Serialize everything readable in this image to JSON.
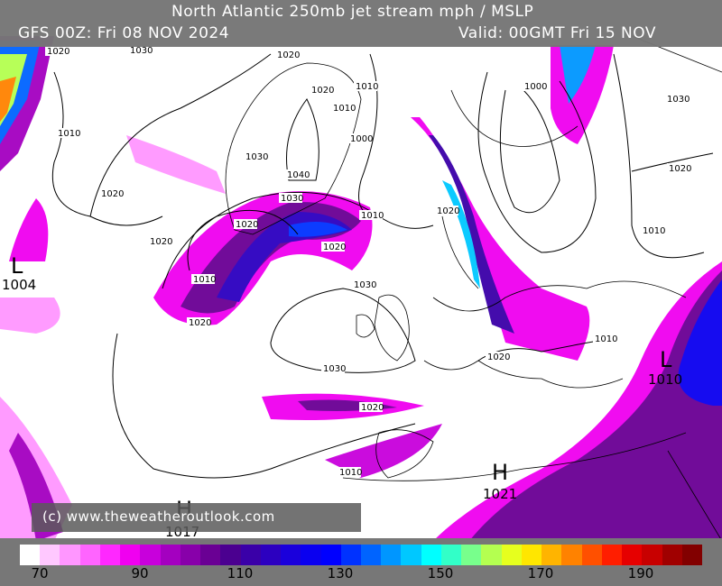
{
  "header": {
    "title": "North Atlantic 250mb jet stream mph / MSLP",
    "run": "GFS 00Z: Fri 08 NOV 2024",
    "valid": "Valid: 00GMT Fri 15 NOV"
  },
  "watermark": "(c) www.theweatheroutlook.com",
  "colorbar": {
    "ticks": [
      "70",
      "90",
      "110",
      "130",
      "150",
      "170",
      "190"
    ],
    "colors": [
      "#ffffff",
      "#ffc8ff",
      "#ff96ff",
      "#ff64ff",
      "#ff28ff",
      "#f000f0",
      "#c800dc",
      "#a400c0",
      "#8800aa",
      "#6a0094",
      "#4b0090",
      "#3a00a8",
      "#2c00c0",
      "#1a00dc",
      "#0a00f0",
      "#0000ff",
      "#0032ff",
      "#0064ff",
      "#0096ff",
      "#00c8ff",
      "#00ffff",
      "#32ffc8",
      "#78ff8c",
      "#b4ff50",
      "#e6ff1e",
      "#ffe600",
      "#ffb400",
      "#ff8200",
      "#ff5000",
      "#ff1e00",
      "#e60000",
      "#c80000",
      "#a00000",
      "#820000"
    ]
  },
  "pressure_centres": [
    {
      "type": "L",
      "value": "1004"
    },
    {
      "type": "L",
      "value": "1010"
    },
    {
      "type": "H",
      "value": "1021"
    },
    {
      "type": "H",
      "value": "1017"
    }
  ],
  "isobar_labels": [
    "1020",
    "1030",
    "1020",
    "1010",
    "1020",
    "1010",
    "1030",
    "1000",
    "1040",
    "1030",
    "1020",
    "1010",
    "1020",
    "1010",
    "1030",
    "1020",
    "1030",
    "1020",
    "1010",
    "1020",
    "1020",
    "1000",
    "1030",
    "1020",
    "1010",
    "1010",
    "1020",
    "1020",
    "1010"
  ]
}
